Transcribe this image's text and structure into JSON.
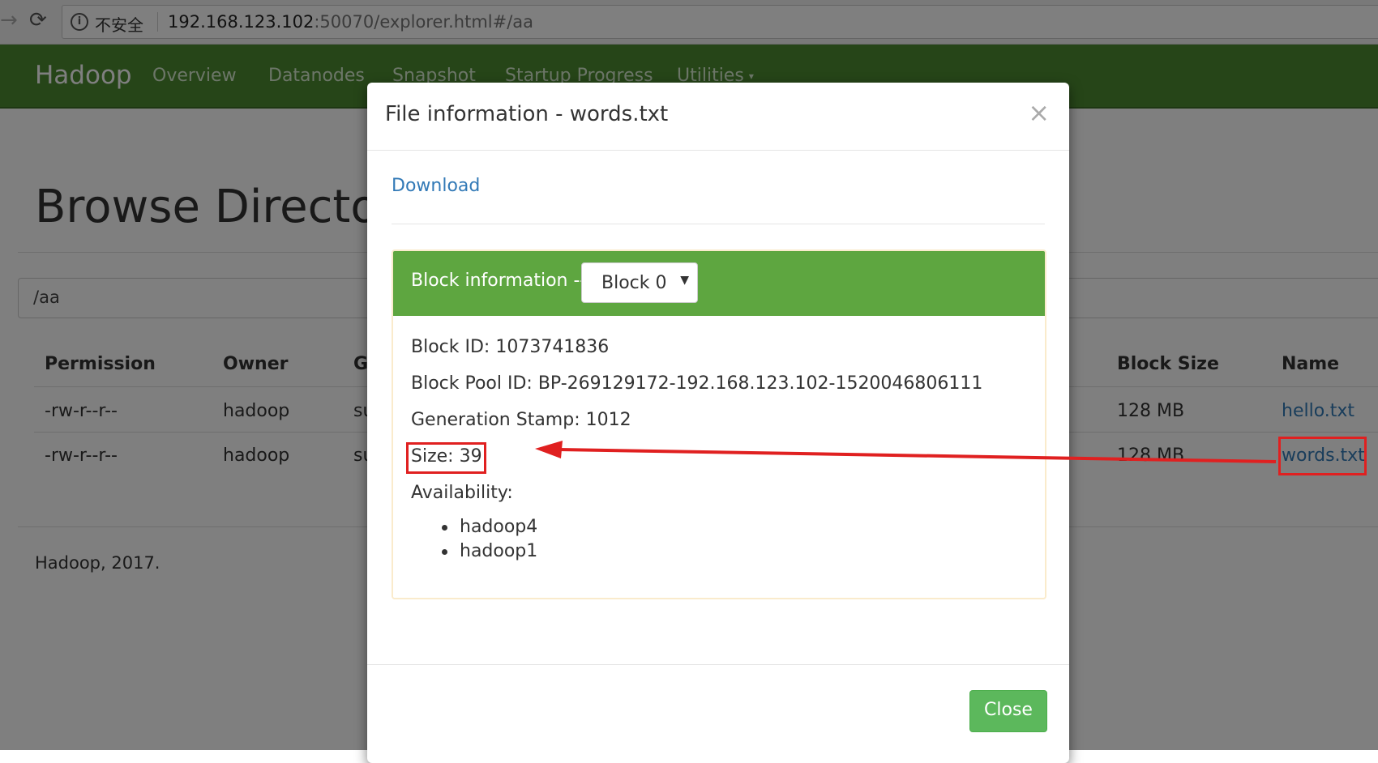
{
  "browser": {
    "security_label": "不安全",
    "url_host": "192.168.123.102",
    "url_rest": ":50070/explorer.html#/aa"
  },
  "navbar": {
    "brand": "Hadoop",
    "links": [
      "Overview",
      "Datanodes",
      "Snapshot",
      "Startup Progress",
      "Utilities"
    ]
  },
  "page": {
    "heading": "Browse Directory",
    "path": "/aa",
    "table": {
      "columns": [
        "Permission",
        "Owner",
        "G",
        "Block Size",
        "Name"
      ],
      "rows": [
        {
          "permission": "-rw-r--r--",
          "owner": "hadoop",
          "group": "su",
          "block_size": "128 MB",
          "name": "hello.txt"
        },
        {
          "permission": "-rw-r--r--",
          "owner": "hadoop",
          "group": "su",
          "block_size": "128 MB",
          "name": "words.txt"
        }
      ]
    },
    "footer": "Hadoop, 2017."
  },
  "modal": {
    "title": "File information - words.txt",
    "close_symbol": "×",
    "download_label": "Download",
    "block_heading": "Block information --",
    "block_selected": "Block 0",
    "block_id": "Block ID: 1073741836",
    "block_pool_id": "Block Pool ID: BP-269129172-192.168.123.102-1520046806111",
    "generation_stamp": "Generation Stamp: 1012",
    "size": "Size: 39",
    "availability_label": "Availability:",
    "availability": [
      "hadoop4",
      "hadoop1"
    ],
    "close_button": "Close"
  },
  "colors": {
    "navbar": "#4c8a31",
    "panel_heading": "#5ea640",
    "close_button": "#5cb85c",
    "annotation": "#e02020",
    "link": "#337ab7"
  },
  "icons": {
    "forward": "arrow-forward-icon",
    "reload": "reload-icon",
    "info": "info-icon",
    "close": "close-icon",
    "dropdown": "dropdown-arrow-icon",
    "annotation_arrow": "annotation-arrow-icon"
  }
}
